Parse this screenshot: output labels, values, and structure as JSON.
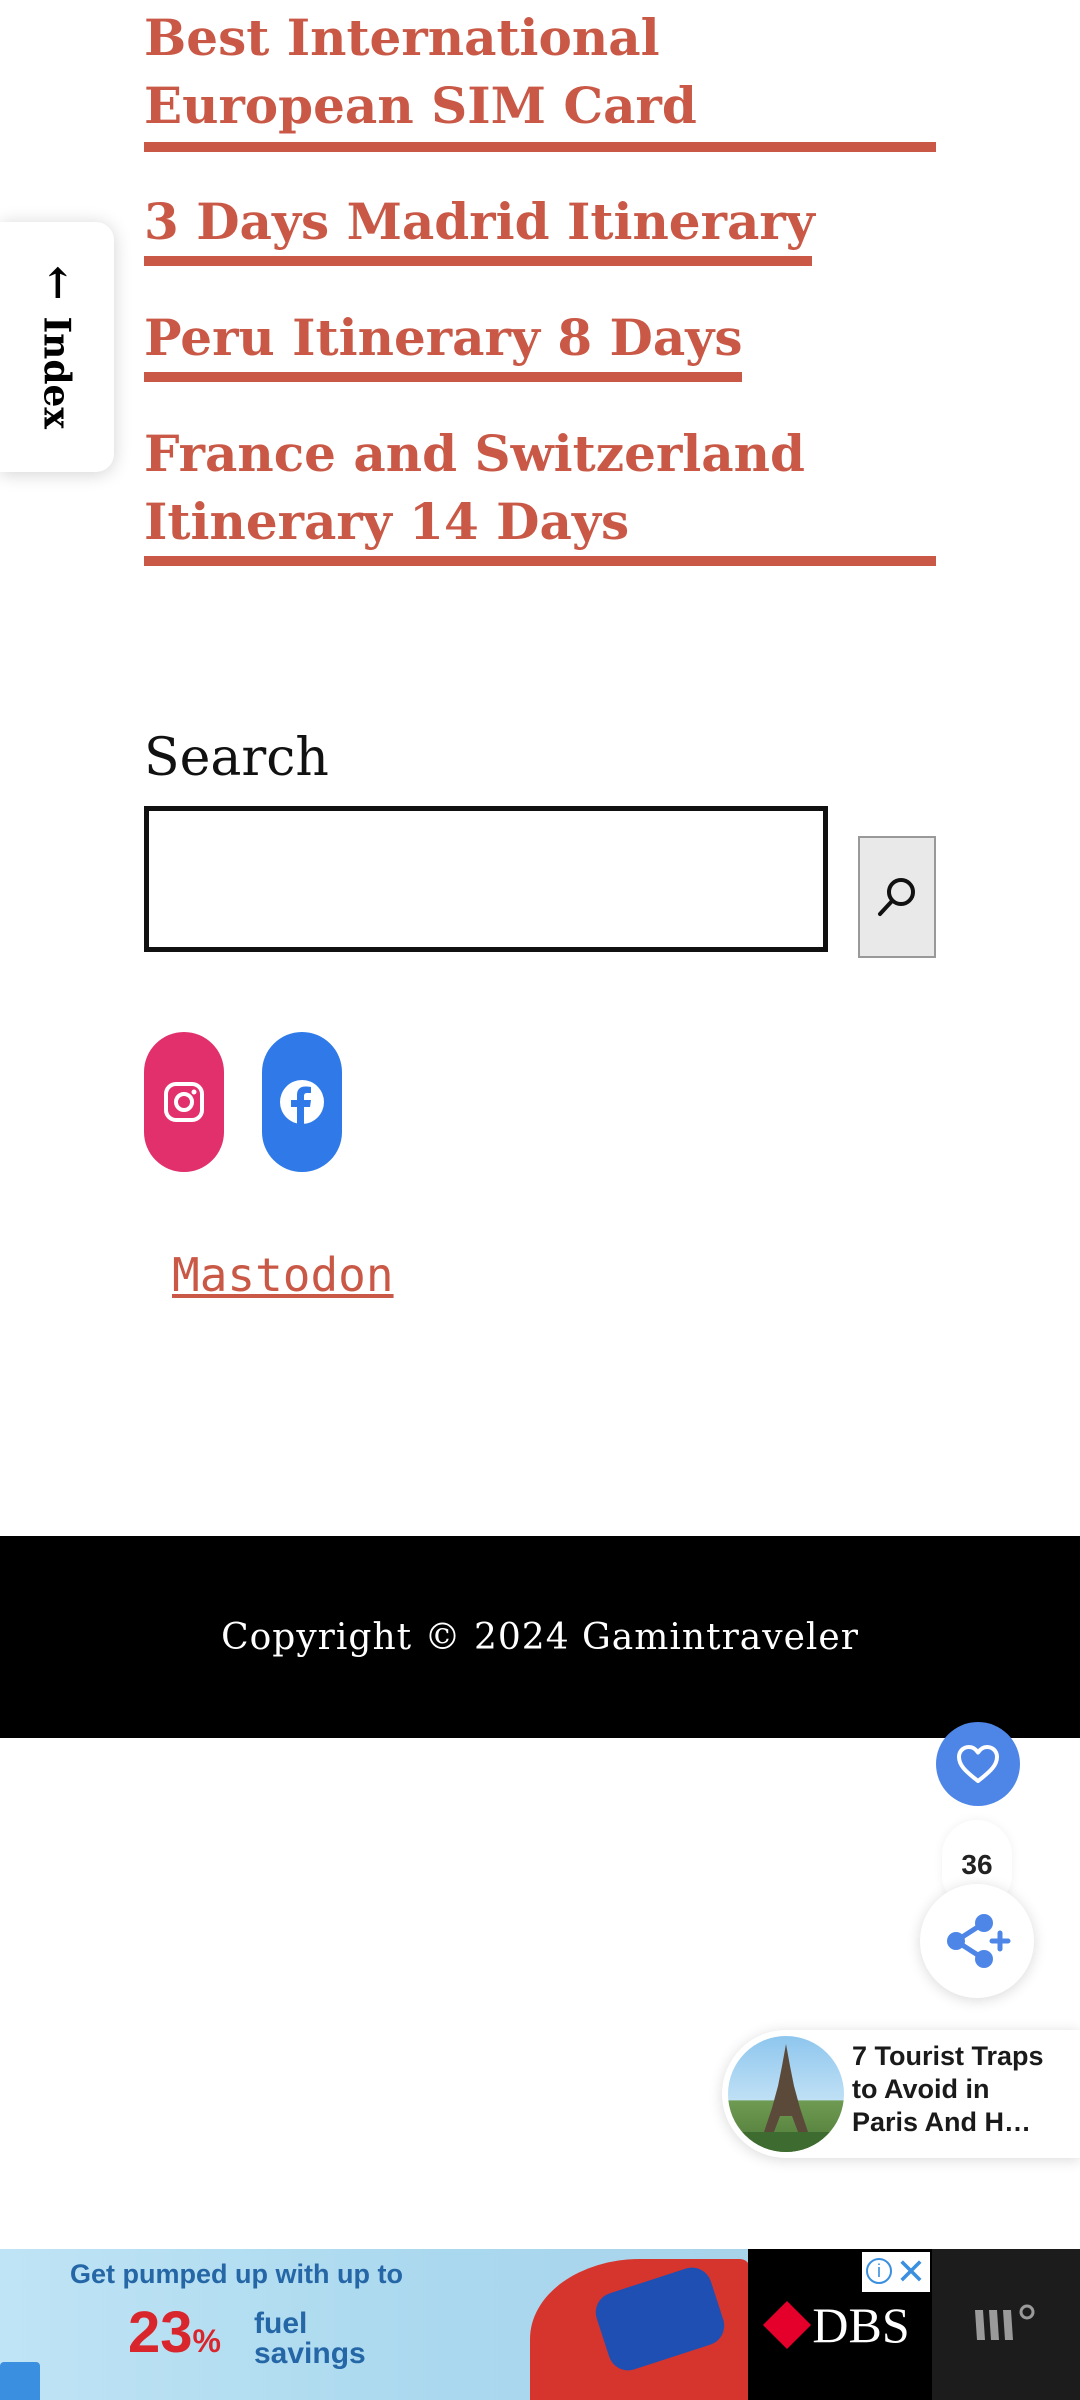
{
  "related_posts": [
    {
      "title_lines": [
        "Best International",
        "European SIM Card"
      ]
    },
    {
      "title_lines": [
        "3 Days Madrid Itinerary"
      ]
    },
    {
      "title_lines": [
        "Peru Itinerary 8 Days"
      ]
    },
    {
      "title_lines": [
        "France and Switzerland",
        "Itinerary 14 Days"
      ]
    }
  ],
  "index_tab": {
    "label": "Index",
    "arrow": "→"
  },
  "search": {
    "label": "Search",
    "value": "",
    "placeholder": "",
    "button_icon": "search-icon"
  },
  "social": {
    "instagram_icon": "instagram-icon",
    "facebook_icon": "facebook-icon",
    "mastodon_label": "Mastodon"
  },
  "footer": {
    "copyright": "Copyright © 2024 Gamintraveler"
  },
  "floating": {
    "like_count": "36",
    "like_icon": "heart-icon",
    "share_icon": "share-icon"
  },
  "promo": {
    "lines": [
      "7 Tourist Traps",
      "to Avoid in",
      "Paris And H…"
    ]
  },
  "ad": {
    "headline": "Get pumped up with up to",
    "percent": "23",
    "percent_sign": "%",
    "fuel_line1": "fuel",
    "fuel_line2": "savings",
    "brand": "DBS",
    "close_symbol": "✕",
    "info_symbol": "i"
  },
  "colors": {
    "link": "#c95946",
    "footer_bg": "#000000",
    "instagram": "#e1306c",
    "facebook": "#2f7ae8",
    "like": "#4e86e8"
  }
}
